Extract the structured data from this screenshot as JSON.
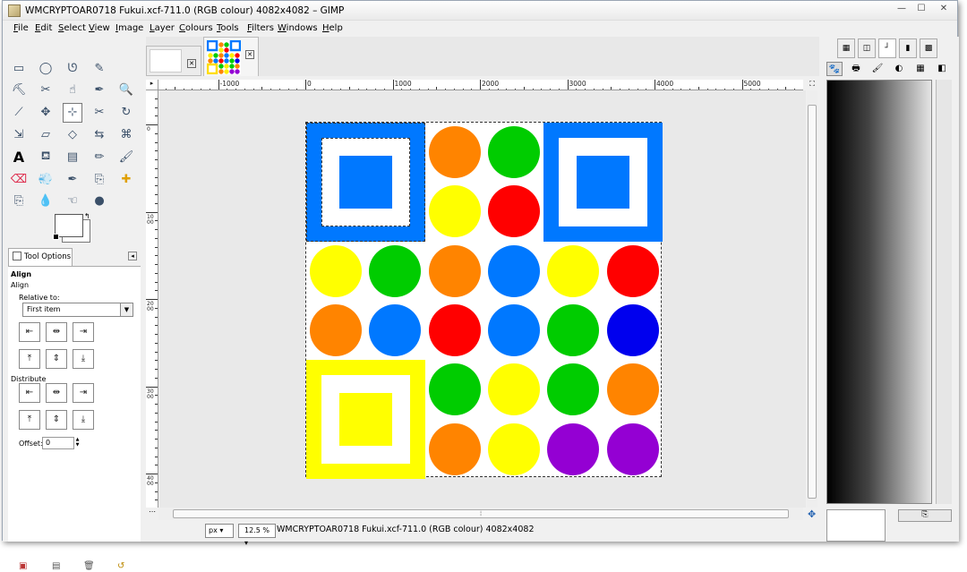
{
  "window": {
    "title": "WMCRYPTOAR0718 Fukui.xcf-711.0 (RGB colour) 4082x4082 – GIMP",
    "controls": {
      "minimize": "—",
      "maximize": "☐",
      "close": "✕"
    }
  },
  "menu": [
    {
      "u": "F",
      "rest": "ile"
    },
    {
      "u": "E",
      "rest": "dit"
    },
    {
      "u": "S",
      "rest": "elect"
    },
    {
      "u": "V",
      "rest": "iew"
    },
    {
      "u": "I",
      "rest": "mage"
    },
    {
      "u": "L",
      "rest": "ayer"
    },
    {
      "u": "C",
      "rest": "olours"
    },
    {
      "u": "T",
      "rest": "ools"
    },
    {
      "u": "F",
      "rest": "ilters"
    },
    {
      "u": "W",
      "rest": "indows"
    },
    {
      "u": "H",
      "rest": "elp"
    }
  ],
  "toolbox": {
    "tools": [
      "rect-select-icon",
      "ellipse-select-icon",
      "free-select-icon",
      "fuzzy-select-icon",
      "",
      "color-select-icon",
      "scissors-select-icon",
      "foreground-select-icon",
      "paths-icon",
      "zoom-icon",
      "measure-icon",
      "move-icon",
      "align-icon",
      "crop-icon",
      "rotate-icon",
      "scale-icon",
      "shear-icon",
      "perspective-icon",
      "flip-icon",
      "cage-transform-icon",
      "text-icon",
      "bucket-fill-icon",
      "blend-icon",
      "pencil-icon",
      "paintbrush-icon",
      "eraser-icon",
      "airbrush-icon",
      "ink-icon",
      "clone-icon",
      "heal-icon",
      "perspective-clone-icon",
      "blur-icon",
      "smudge-icon",
      "dodge-burn-icon",
      ""
    ],
    "active_tool": 12,
    "tool_glyphs": [
      "▭",
      "◯",
      "ᘎ",
      "✎",
      "",
      "⛏",
      "✂",
      "☝",
      "✒",
      "🔍",
      "⟋",
      "✥",
      "⊹",
      "✂",
      "↻",
      "⇲",
      "▱",
      "◇",
      "⇆",
      "⌘",
      "A",
      "⛾",
      "▤",
      "✏",
      "🖌",
      "⌫",
      "💨",
      "✒",
      "⎘",
      "✚",
      "⎘",
      "💧",
      "☜",
      "●",
      ""
    ]
  },
  "tool_options": {
    "tab_label": "Tool Options",
    "heading": "Align",
    "subheading": "Align",
    "relative_label": "Relative to:",
    "relative_value": "First item",
    "distribute_label": "Distribute",
    "offset_label": "Offset:",
    "offset_value": "0",
    "align_glyphs": [
      "⇤",
      "⇹",
      "⇥",
      "⤒",
      "⇕",
      "⤓"
    ],
    "distribute_glyphs": [
      "⇤",
      "⇹",
      "⇥",
      "⤒",
      "⇕",
      "⤓"
    ]
  },
  "ruler": {
    "h_labels": [
      {
        "v": "-1000",
        "at": -1000
      },
      {
        "v": "0",
        "at": 0
      },
      {
        "v": "1000",
        "at": 1000
      },
      {
        "v": "2000",
        "at": 2000
      },
      {
        "v": "3000",
        "at": 3000
      },
      {
        "v": "4000",
        "at": 4000
      },
      {
        "v": "5000",
        "at": 5000
      }
    ],
    "v_labels": [
      {
        "v": "0",
        "at": 0
      },
      {
        "v": "1000",
        "at": 1000
      },
      {
        "v": "2000",
        "at": 2000
      },
      {
        "v": "3000",
        "at": 3000
      },
      {
        "v": "4000",
        "at": 4000
      }
    ]
  },
  "image": {
    "squares": [
      {
        "cell": [
          0,
          0
        ],
        "color": "#0078ff"
      },
      {
        "cell": [
          4,
          0
        ],
        "color": "#0078ff"
      },
      {
        "cell": [
          0,
          4
        ],
        "color": "#ffff00"
      }
    ],
    "circles": [
      {
        "c": 2,
        "r": 0,
        "color": "#ff8400"
      },
      {
        "c": 3,
        "r": 0,
        "color": "#00cc00"
      },
      {
        "c": 2,
        "r": 1,
        "color": "#ffff00"
      },
      {
        "c": 3,
        "r": 1,
        "color": "#ff0000"
      },
      {
        "c": 0,
        "r": 2,
        "color": "#ffff00"
      },
      {
        "c": 1,
        "r": 2,
        "color": "#00cc00"
      },
      {
        "c": 2,
        "r": 2,
        "color": "#ff8400"
      },
      {
        "c": 3,
        "r": 2,
        "color": "#0078ff"
      },
      {
        "c": 4,
        "r": 2,
        "color": "#ffff00"
      },
      {
        "c": 5,
        "r": 2,
        "color": "#ff0000"
      },
      {
        "c": 0,
        "r": 3,
        "color": "#ff8400"
      },
      {
        "c": 1,
        "r": 3,
        "color": "#0078ff"
      },
      {
        "c": 2,
        "r": 3,
        "color": "#ff0000"
      },
      {
        "c": 3,
        "r": 3,
        "color": "#0078ff"
      },
      {
        "c": 4,
        "r": 3,
        "color": "#00cc00"
      },
      {
        "c": 5,
        "r": 3,
        "color": "#0000ee"
      },
      {
        "c": 2,
        "r": 4,
        "color": "#00cc00"
      },
      {
        "c": 3,
        "r": 4,
        "color": "#ffff00"
      },
      {
        "c": 4,
        "r": 4,
        "color": "#00cc00"
      },
      {
        "c": 5,
        "r": 4,
        "color": "#ff8400"
      },
      {
        "c": 2,
        "r": 5,
        "color": "#ff8400"
      },
      {
        "c": 3,
        "r": 5,
        "color": "#ffff00"
      },
      {
        "c": 4,
        "r": 5,
        "color": "#9400d3"
      },
      {
        "c": 5,
        "r": 5,
        "color": "#9400d3"
      }
    ]
  },
  "status": {
    "unit": "px",
    "zoom": "12.5 %",
    "text": "WMCRYPTOAR0718 Fukui.xcf-711.0 (RGB colour) 4082x4082"
  },
  "dock": {
    "tab_glyphs": [
      "▦",
      "◫",
      "┘",
      "▮",
      "▩"
    ],
    "tool_glyphs": [
      "🐾",
      "🖶",
      "🖌",
      "◐",
      "▦",
      "◧"
    ]
  }
}
